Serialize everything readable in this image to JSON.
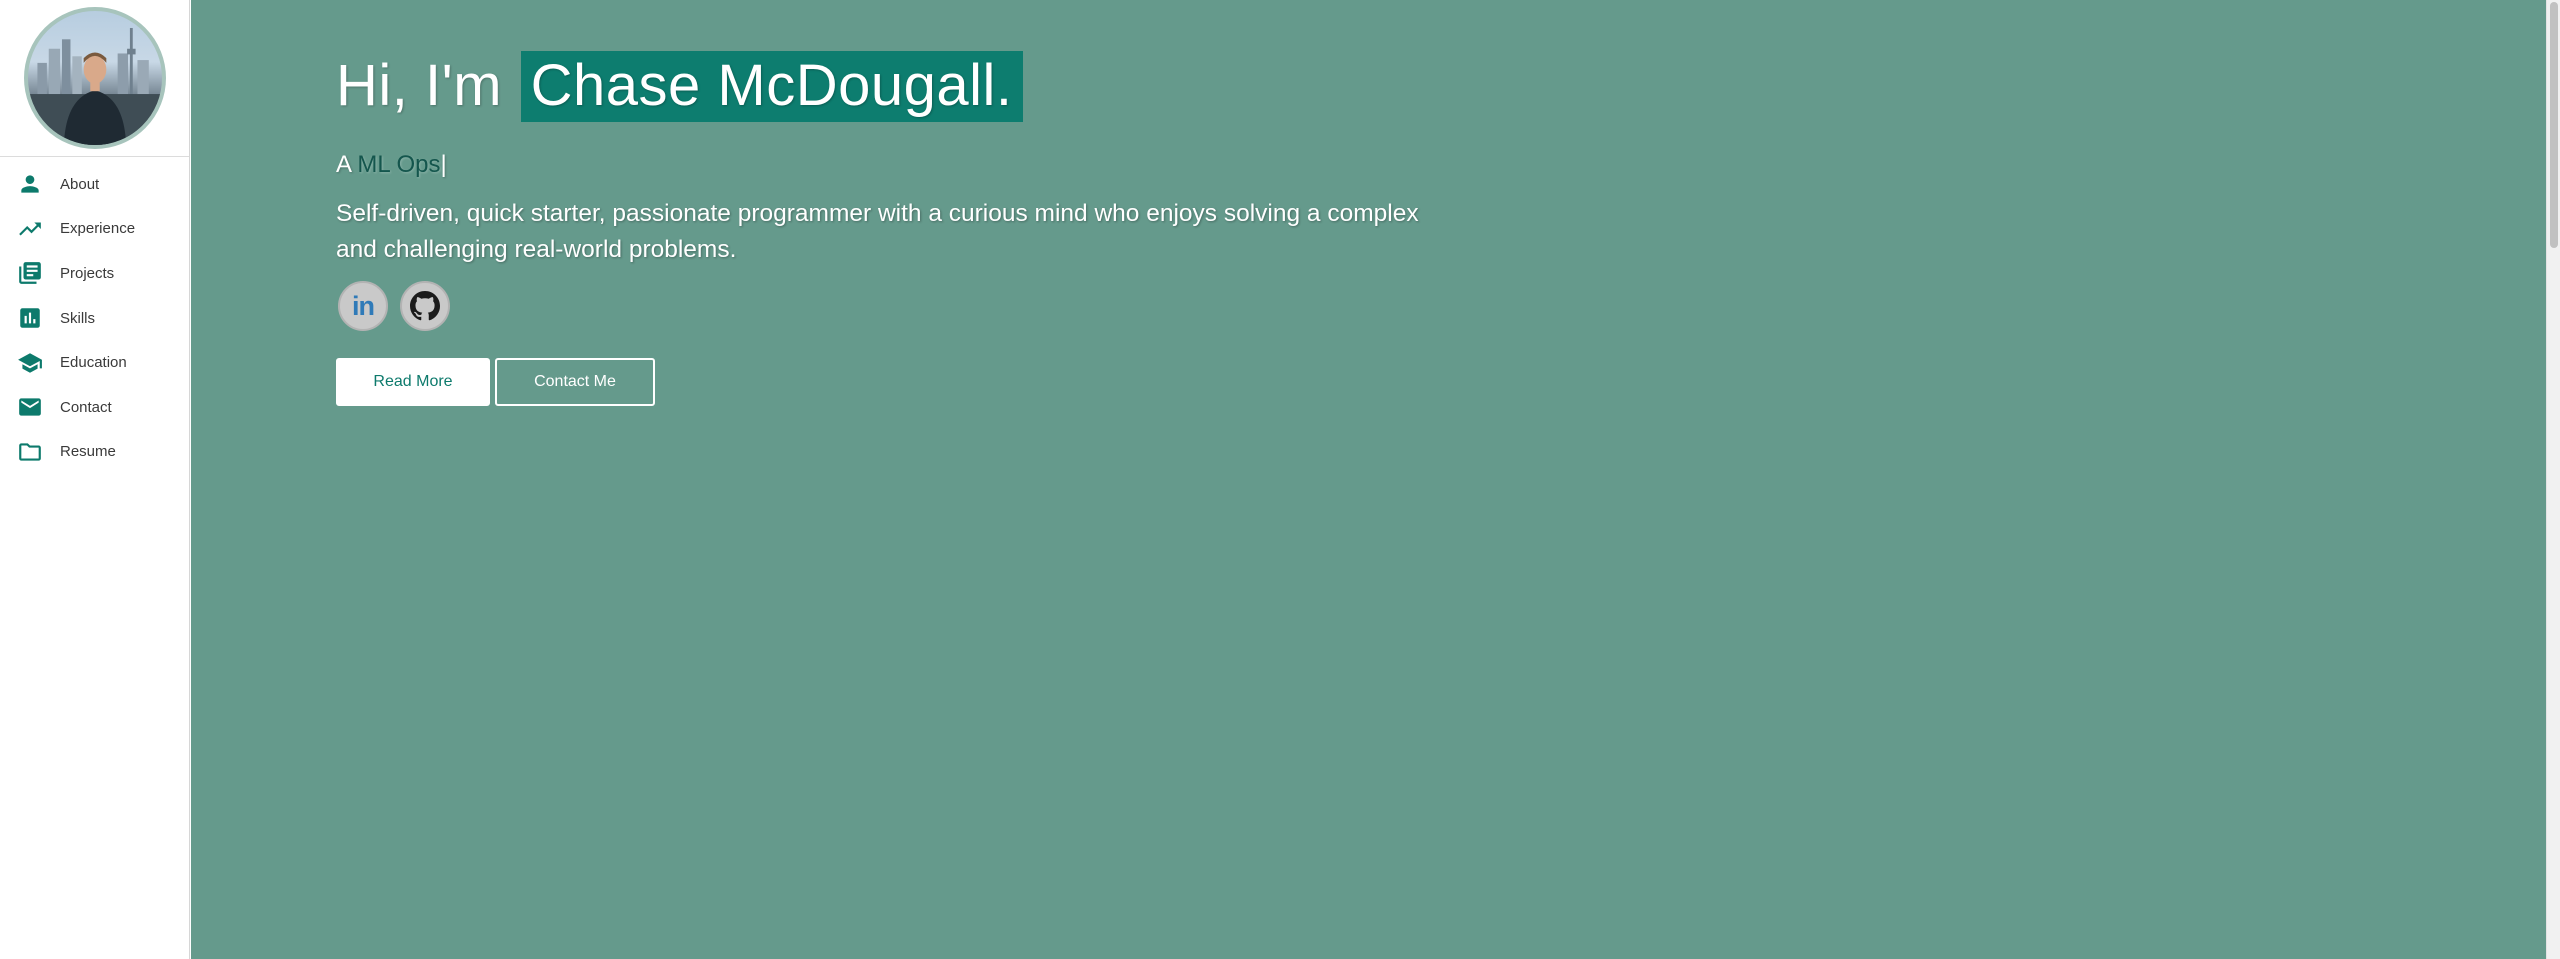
{
  "sidebar": {
    "items": [
      {
        "label": "About",
        "icon": "person-icon"
      },
      {
        "label": "Experience",
        "icon": "trending-up-icon"
      },
      {
        "label": "Projects",
        "icon": "library-books-icon"
      },
      {
        "label": "Skills",
        "icon": "bar-chart-icon"
      },
      {
        "label": "Education",
        "icon": "school-icon"
      },
      {
        "label": "Contact",
        "icon": "mail-icon"
      },
      {
        "label": "Resume",
        "icon": "folder-icon"
      }
    ]
  },
  "hero": {
    "greeting": "Hi, I'm",
    "name": "Chase McDougall.",
    "typed_prefix": "A",
    "typed_role": "ML Ops",
    "cursor": "|",
    "tagline": "Self-driven, quick starter, passionate programmer with a curious mind who enjoys solving a complex and challenging real-world problems.",
    "linkedin_text": "in",
    "read_more_label": "Read More",
    "contact_label": "Contact Me"
  },
  "colors": {
    "accent": "#0d7a6c",
    "hero_background": "#659a8c",
    "name_highlight": "#0d7d6f"
  }
}
